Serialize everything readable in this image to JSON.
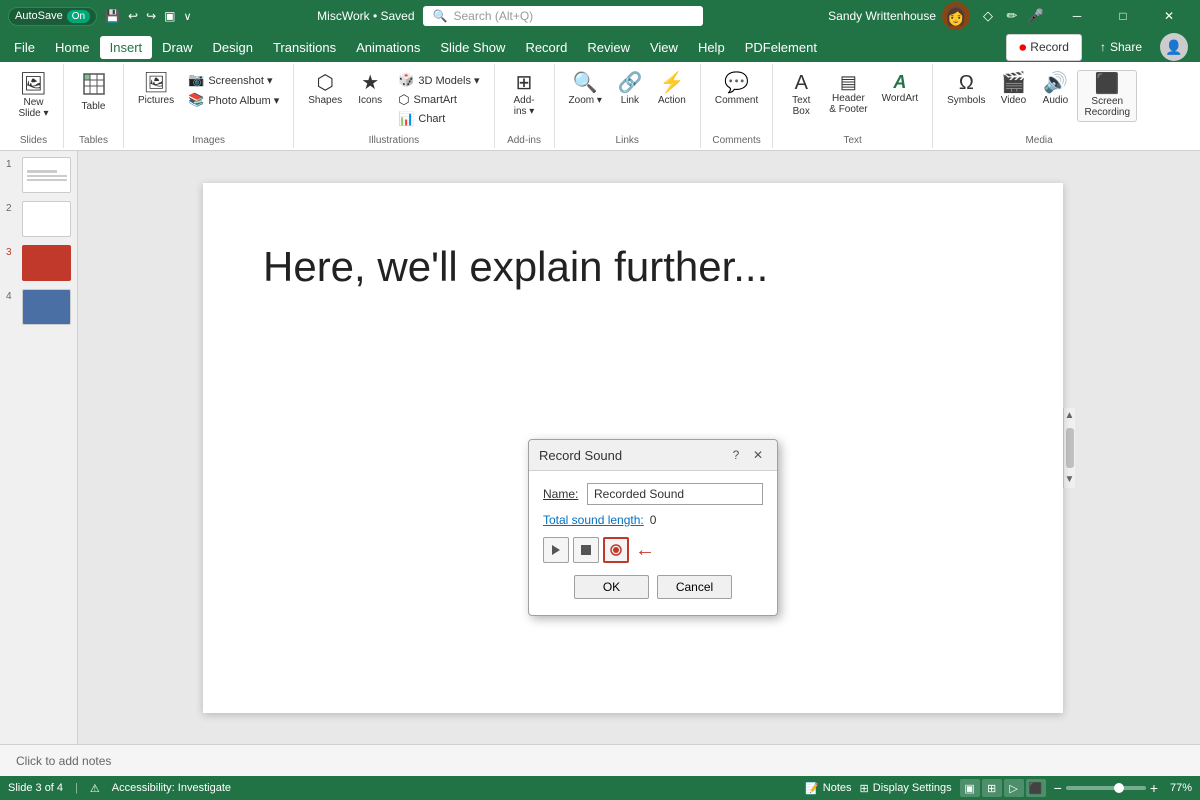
{
  "titleBar": {
    "autosave": "AutoSave",
    "toggleState": "On",
    "filename": "MiscWork • Saved",
    "searchPlaceholder": "Search (Alt+Q)",
    "userName": "Sandy Writtenhouse",
    "windowControls": [
      "─",
      "□",
      "✕"
    ]
  },
  "menuBar": {
    "items": [
      "File",
      "Home",
      "Insert",
      "Draw",
      "Design",
      "Transitions",
      "Animations",
      "Slide Show",
      "Record",
      "Review",
      "View",
      "Help",
      "PDFelement"
    ],
    "activeItem": "Insert"
  },
  "ribbon": {
    "groups": [
      {
        "name": "Slides",
        "items": [
          {
            "label": "New\nSlide",
            "type": "large"
          }
        ]
      },
      {
        "name": "Tables",
        "items": [
          {
            "label": "Table",
            "type": "large"
          }
        ]
      },
      {
        "name": "Images",
        "items": [
          {
            "label": "Pictures",
            "type": "large"
          },
          {
            "label": "Screenshot ~",
            "type": "small"
          },
          {
            "label": "Photo Album ~",
            "type": "small"
          }
        ]
      },
      {
        "name": "Illustrations",
        "items": [
          {
            "label": "Shapes",
            "type": "large"
          },
          {
            "label": "Icons",
            "type": "large"
          },
          {
            "label": "3D Models ~",
            "type": "small"
          },
          {
            "label": "SmartArt",
            "type": "small"
          },
          {
            "label": "Chart",
            "type": "small"
          }
        ]
      },
      {
        "name": "Add-ins",
        "items": [
          {
            "label": "Add-\nins ~",
            "type": "large"
          }
        ]
      },
      {
        "name": "Links",
        "items": [
          {
            "label": "Zoom ~",
            "type": "large"
          },
          {
            "label": "Link",
            "type": "large"
          },
          {
            "label": "Action",
            "type": "large"
          }
        ]
      },
      {
        "name": "Comments",
        "items": [
          {
            "label": "Comment",
            "type": "large"
          }
        ]
      },
      {
        "name": "Text",
        "items": [
          {
            "label": "Text\nBox",
            "type": "large"
          },
          {
            "label": "Header\n& Footer",
            "type": "large"
          },
          {
            "label": "WordArt",
            "type": "large"
          }
        ]
      },
      {
        "name": "Media",
        "items": [
          {
            "label": "Symbols",
            "type": "large"
          },
          {
            "label": "Video",
            "type": "large"
          },
          {
            "label": "Audio",
            "type": "large"
          },
          {
            "label": "Screen\nRecording",
            "type": "large"
          }
        ]
      }
    ],
    "recordBtn": "Record",
    "shareBtn": "Share"
  },
  "slides": [
    {
      "num": 1,
      "type": "blank"
    },
    {
      "num": 2,
      "type": "white"
    },
    {
      "num": 3,
      "type": "red",
      "active": true
    },
    {
      "num": 4,
      "type": "blue"
    }
  ],
  "slideContent": {
    "title": "Here, we'll explain further..."
  },
  "dialog": {
    "title": "Record Sound",
    "nameLabel": "Name:",
    "nameValue": "Recorded Sound",
    "lengthLabel": "Total sound length:",
    "lengthValue": "0",
    "controls": {
      "play": "▶",
      "stop": "■",
      "record": "●"
    },
    "okLabel": "OK",
    "cancelLabel": "Cancel"
  },
  "statusBar": {
    "slideInfo": "Slide 3 of 4",
    "accessibility": "Accessibility: Investigate",
    "notesLabel": "Notes",
    "displaySettings": "Display Settings",
    "zoom": "77%"
  }
}
